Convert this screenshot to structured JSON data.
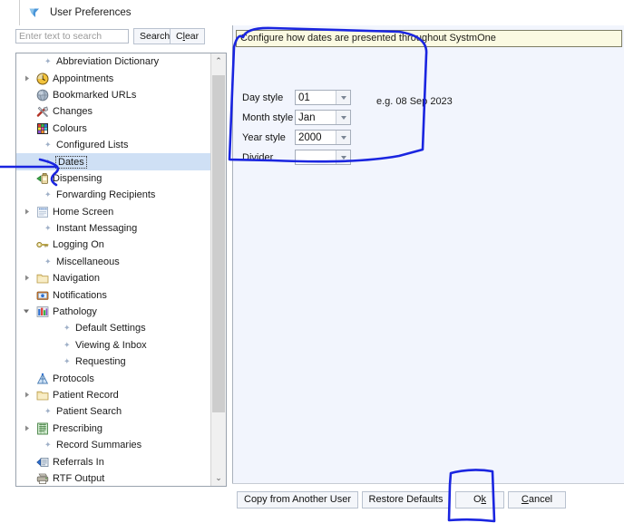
{
  "window": {
    "title": "User Preferences",
    "app_icon": "funnel-icon"
  },
  "search": {
    "placeholder": "Enter text to search",
    "value": "",
    "search_label": "Search",
    "clear_label_pre": "C",
    "clear_label_mnemonic": "l",
    "clear_label_post": "ear"
  },
  "tree": {
    "items": [
      {
        "label": "Abbreviation Dictionary",
        "depth": 1,
        "icon": "bullet-icon",
        "expander": "none",
        "selected": false
      },
      {
        "label": "Appointments",
        "depth": 0,
        "icon": "clock-icon",
        "expander": "closed",
        "selected": false
      },
      {
        "label": "Bookmarked URLs",
        "depth": 0,
        "icon": "globe-icon",
        "expander": "none",
        "selected": false
      },
      {
        "label": "Changes",
        "depth": 0,
        "icon": "tools-icon",
        "expander": "none",
        "selected": false
      },
      {
        "label": "Colours",
        "depth": 0,
        "icon": "palette-icon",
        "expander": "none",
        "selected": false
      },
      {
        "label": "Configured Lists",
        "depth": 1,
        "icon": "bullet-icon",
        "expander": "none",
        "selected": false
      },
      {
        "label": "Dates",
        "depth": 1,
        "icon": "bullet-icon",
        "expander": "none",
        "selected": true
      },
      {
        "label": "Dispensing",
        "depth": 0,
        "icon": "dispensing-icon",
        "expander": "none",
        "selected": false
      },
      {
        "label": "Forwarding Recipients",
        "depth": 1,
        "icon": "bullet-icon",
        "expander": "none",
        "selected": false
      },
      {
        "label": "Home Screen",
        "depth": 0,
        "icon": "home-screen-icon",
        "expander": "closed",
        "selected": false
      },
      {
        "label": "Instant Messaging",
        "depth": 1,
        "icon": "bullet-icon",
        "expander": "none",
        "selected": false
      },
      {
        "label": "Logging On",
        "depth": 0,
        "icon": "key-icon",
        "expander": "none",
        "selected": false
      },
      {
        "label": "Miscellaneous",
        "depth": 1,
        "icon": "bullet-icon",
        "expander": "none",
        "selected": false
      },
      {
        "label": "Navigation",
        "depth": 0,
        "icon": "folder-icon",
        "expander": "closed",
        "selected": false
      },
      {
        "label": "Notifications",
        "depth": 0,
        "icon": "notification-icon",
        "expander": "none",
        "selected": false
      },
      {
        "label": "Pathology",
        "depth": 0,
        "icon": "pathology-icon",
        "expander": "open",
        "selected": false
      },
      {
        "label": "Default Settings",
        "depth": 2,
        "icon": "bullet-icon",
        "expander": "none",
        "selected": false
      },
      {
        "label": "Viewing & Inbox",
        "depth": 2,
        "icon": "bullet-icon",
        "expander": "none",
        "selected": false
      },
      {
        "label": "Requesting",
        "depth": 2,
        "icon": "bullet-icon",
        "expander": "none",
        "selected": false
      },
      {
        "label": "Protocols",
        "depth": 0,
        "icon": "protocols-icon",
        "expander": "none",
        "selected": false
      },
      {
        "label": "Patient Record",
        "depth": 0,
        "icon": "folder-icon",
        "expander": "closed",
        "selected": false
      },
      {
        "label": "Patient Search",
        "depth": 1,
        "icon": "bullet-icon",
        "expander": "none",
        "selected": false
      },
      {
        "label": "Prescribing",
        "depth": 0,
        "icon": "prescribing-icon",
        "expander": "closed",
        "selected": false
      },
      {
        "label": "Record Summaries",
        "depth": 1,
        "icon": "bullet-icon",
        "expander": "none",
        "selected": false
      },
      {
        "label": "Referrals In",
        "depth": 0,
        "icon": "referrals-icon",
        "expander": "none",
        "selected": false
      },
      {
        "label": "RTF Output",
        "depth": 0,
        "icon": "printer-icon",
        "expander": "none",
        "selected": false
      }
    ],
    "scroll_up_glyph": "⌃",
    "scroll_down_glyph": "⌄"
  },
  "content": {
    "banner": "Configure how dates are presented throughout SystmOne",
    "fields": [
      {
        "label": "Day style",
        "value": "01"
      },
      {
        "label": "Month style",
        "value": "Jan"
      },
      {
        "label": "Year style",
        "value": "2000"
      },
      {
        "label": "Divider",
        "value": ""
      }
    ],
    "example": "e.g. 08 Sep 2023"
  },
  "buttons": {
    "copy": "Copy from Another User",
    "restore": "Restore Defaults",
    "ok_pre": "O",
    "ok_mnemonic": "k",
    "cancel_mnemonic": "C",
    "cancel_post": "ancel"
  },
  "annotations": {
    "color": "#1a25e0",
    "marks": [
      {
        "name": "arrow-to-dates",
        "shape": "arrow"
      },
      {
        "name": "box-date-settings",
        "shape": "rectangle"
      },
      {
        "name": "box-ok-button",
        "shape": "rectangle"
      }
    ]
  },
  "colors": {
    "banner_bg": "#fbfae2",
    "panel_bg": "#f2f5fd",
    "selection_bg": "#cfe0f5",
    "annotation": "#1a25e0"
  }
}
